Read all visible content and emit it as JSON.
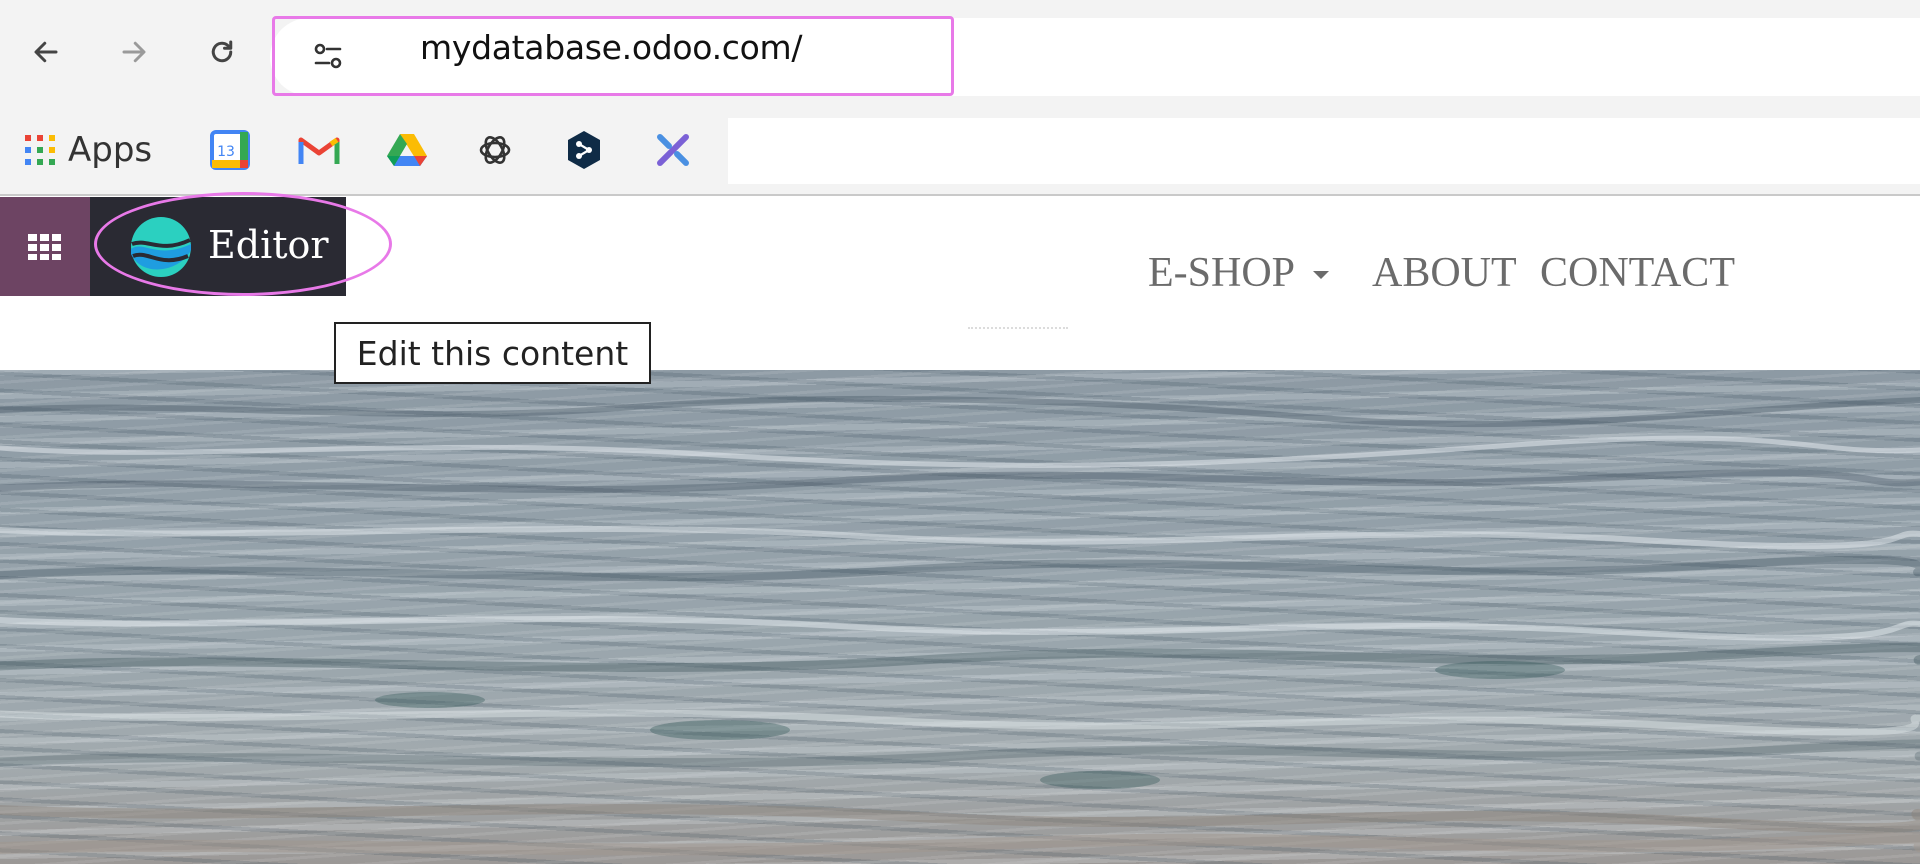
{
  "browser": {
    "url": "mydatabase.odoo.com/",
    "nav": {
      "back_icon": "arrow-left-icon",
      "forward_icon": "arrow-right-icon",
      "reload_icon": "reload-icon"
    },
    "site_settings_icon": "tune-icon"
  },
  "bookmarks": {
    "apps_label": "Apps",
    "calendar_day": "13",
    "items": [
      "apps-grid-icon",
      "google-calendar-icon",
      "gmail-icon",
      "google-drive-icon",
      "chatgpt-icon",
      "deepl-icon",
      "tool-icon"
    ]
  },
  "odoo": {
    "editor_label": "Editor",
    "menu": [
      {
        "label": "E-SHOP",
        "has_dropdown": true
      },
      {
        "label": "ABOUT"
      },
      {
        "label": "CONTACT"
      }
    ],
    "tooltip": "Edit this content",
    "colors": {
      "apps_bg": "#6d4463",
      "editor_bg": "#2a2a33",
      "highlight": "#e879e8"
    }
  }
}
